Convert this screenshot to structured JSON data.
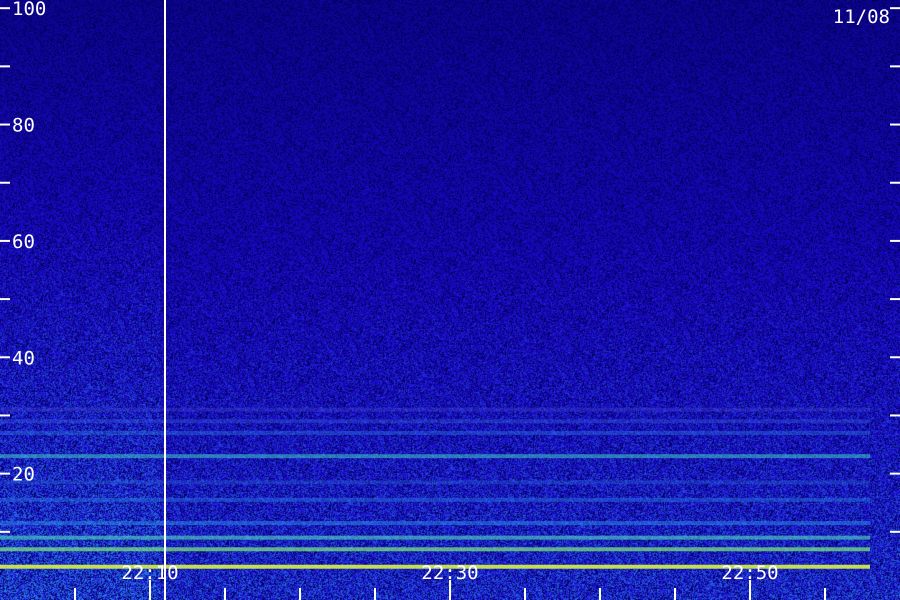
{
  "chart_data": {
    "type": "heatmap",
    "date_label": "11/08",
    "y_ticks": [
      20,
      40,
      60,
      80,
      100
    ],
    "y_minor_ticks": [
      10,
      30,
      50,
      70,
      90
    ],
    "ylim": [
      0,
      110
    ],
    "x_labels": [
      "22:10",
      "22:30",
      "22:50"
    ],
    "x_label_minutes": [
      10,
      30,
      50
    ],
    "xlim_minutes": [
      0,
      60
    ],
    "x_minor_minutes": [
      5,
      15,
      20,
      25,
      35,
      40,
      45,
      55
    ],
    "marker_minutes": 11,
    "bands": [
      {
        "value": 4.0,
        "level": 0.9,
        "color": "#d7f24a"
      },
      {
        "value": 7.0,
        "level": 0.7,
        "color": "#7ef07a"
      },
      {
        "value": 9.0,
        "level": 0.6,
        "color": "#52e0c2"
      },
      {
        "value": 11.5,
        "level": 0.45,
        "color": "#2fa0f0"
      },
      {
        "value": 15.5,
        "level": 0.4,
        "color": "#2a8ae8"
      },
      {
        "value": 18.5,
        "level": 0.35,
        "color": "#2a6ee0"
      },
      {
        "value": 23.0,
        "level": 0.55,
        "color": "#40d0c8"
      },
      {
        "value": 27.0,
        "level": 0.4,
        "color": "#2a7ee6"
      },
      {
        "value": 29.0,
        "level": 0.35,
        "color": "#3a66e8"
      },
      {
        "value": 31.0,
        "level": 0.3,
        "color": "#4b52e0"
      }
    ],
    "colors": {
      "background": "#000000",
      "low": "#1b0f6e",
      "mid": "#2740d8",
      "high": "#39e6b4",
      "peak": "#e6f04a",
      "text": "#ffffff"
    }
  }
}
